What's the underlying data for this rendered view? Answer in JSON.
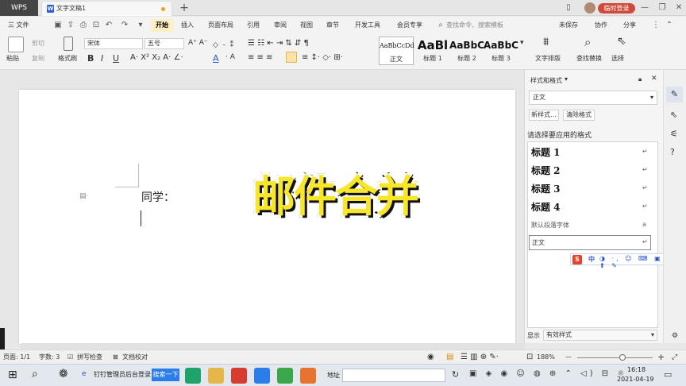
{
  "titlebar": {
    "app_tab": "WPS",
    "doc_tab": "文字文稿1",
    "new_tab": "+",
    "login": "临时登录",
    "window_controls": [
      "minimize-icon",
      "maximize-icon",
      "close-icon"
    ]
  },
  "menubar": {
    "file": "三 文件",
    "tabs": [
      "开始",
      "插入",
      "页面布局",
      "引用",
      "审阅",
      "视图",
      "章节",
      "开发工具",
      "会员专享"
    ],
    "search_placeholder": "查找命令、搜索模板",
    "unsaved": "未保存",
    "collab": "协作",
    "share": "分享"
  },
  "ribbon": {
    "paste": "粘贴",
    "cut": "剪切",
    "copy": "复制",
    "format_painter": "格式刷",
    "font_name": "宋体",
    "font_size": "五号",
    "styles": [
      {
        "preview": "AaBbCcDd",
        "label": "正文"
      },
      {
        "preview": "AaBl",
        "label": "标题 1"
      },
      {
        "preview": "AaBbC",
        "label": "标题 2"
      },
      {
        "preview": "AaBbC",
        "label": "标题 3"
      }
    ],
    "text_layout": "文字排版",
    "find_replace": "查找替换",
    "select": "选择"
  },
  "document": {
    "text": "同学：",
    "overlay_title": "邮件合并"
  },
  "panel": {
    "title": "样式和格式",
    "current_style": "正文",
    "new_style": "新样式...",
    "clear_format": "清除格式",
    "prompt": "请选择要应用的格式",
    "styles": [
      "标题  1",
      "标题  2",
      "标题  3",
      "标题  4"
    ],
    "default_font": "默认段落字体",
    "selected": "正文",
    "show_label": "显示",
    "show_value": "有效样式"
  },
  "ime": {
    "label": "中"
  },
  "statusbar": {
    "page": "页面: 1/1",
    "words": "字数: 3",
    "spell": "拼写检查",
    "proof": "文档校对",
    "zoom": "188%",
    "zoom_fraction": 0.6
  },
  "taskbar": {
    "app1": "钉钉管理员后台登录",
    "search_btn": "搜索一下",
    "address": "地址",
    "time": "16:18",
    "date": "2021-04-19"
  },
  "colors": {
    "accent": "#fff0c4",
    "login": "#cf4a3a",
    "overlay_fill": "#f7e62a"
  }
}
